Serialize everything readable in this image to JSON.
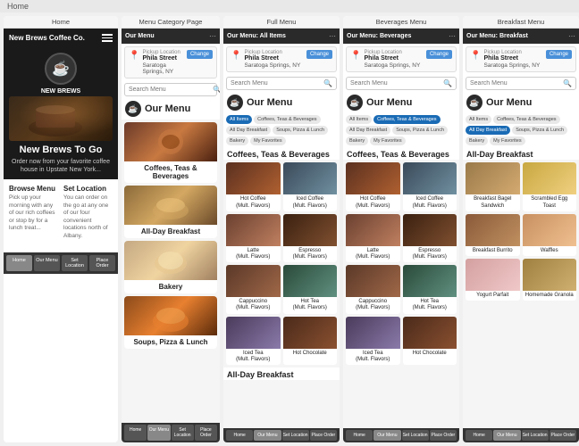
{
  "breadcrumb": "Home",
  "panels": {
    "home": {
      "label": "Home",
      "header": {
        "title": "New Brews Coffee Co.",
        "menu_icon": "☰"
      },
      "logo": "☕",
      "hero_title": "New Brews To Go",
      "hero_subtitle": "Order now from your favorite coffee house in Upstate New York...",
      "features": [
        {
          "title": "Browse Menu",
          "text": "Pick up your morning with any of our rich coffees or stop by for a lunch treat..."
        },
        {
          "title": "Set Location",
          "text": "You can order on the go at any one of our four convenient locations north of Albany."
        }
      ],
      "nav": [
        "Home",
        "Our Menu",
        "Set Location",
        "Place Order"
      ]
    },
    "menu_category": {
      "label": "Menu Category Page",
      "header_title": "Our Menu",
      "pickup": {
        "label": "Pickup Location",
        "address": "Phila Street",
        "city": "Saratoga Springs, NY",
        "change_btn": "Change"
      },
      "search_placeholder": "Search Menu",
      "our_menu_label": "Our Menu",
      "categories": [
        {
          "name": "Coffees, Teas & Beverages",
          "img": "coffee-img"
        },
        {
          "name": "All-Day Breakfast",
          "img": "breakfast-img"
        },
        {
          "name": "Bakery",
          "img": "bakery-img"
        },
        {
          "name": "Soups, Pizza & Lunch",
          "img": "soups-img"
        }
      ],
      "nav": [
        "Home",
        "Our Menu",
        "Set Location",
        "Place Order"
      ]
    },
    "full_menu": {
      "label": "Full Menu",
      "header_title": "Our Menu: All Items",
      "pickup": {
        "label": "Pickup Location",
        "address": "Phila Street",
        "city": "Saratoga Springs, NY",
        "change_btn": "Change"
      },
      "search_placeholder": "Search Menu",
      "our_menu_label": "Our Menu",
      "filter_tabs": [
        {
          "label": "All Items",
          "active": true
        },
        {
          "label": "Coffees, Teas & Beverages",
          "active": false
        },
        {
          "label": "All Day Breakfast",
          "active": false
        },
        {
          "label": "Soups, Pizza & Lunch",
          "active": false
        },
        {
          "label": "Bakery",
          "active": false
        },
        {
          "label": "My Favorites",
          "active": false
        }
      ],
      "sections": [
        {
          "title": "Coffees, Teas & Beverages",
          "items": [
            {
              "name": "Hot Coffee",
              "sub": "(Mult. Flavors)",
              "img": "hot-coffee"
            },
            {
              "name": "Iced Coffee",
              "sub": "(Mult. Flavors)",
              "img": "iced-coffee"
            },
            {
              "name": "Latte",
              "sub": "(Mult. Flavors)",
              "img": "latte"
            },
            {
              "name": "Espresso",
              "sub": "(Mult. Flavors)",
              "img": "espresso"
            },
            {
              "name": "Cappuccino",
              "sub": "(Mult. Flavors)",
              "img": "cappuccino"
            },
            {
              "name": "Hot Tea",
              "sub": "(Mult. Flavors)",
              "img": "hot-tea"
            },
            {
              "name": "Iced Tea",
              "sub": "(Mult. Flavors)",
              "img": "iced-tea"
            },
            {
              "name": "Hot Chocolate",
              "sub": "",
              "img": "hot-chocolate"
            }
          ]
        },
        {
          "title": "All-Day Breakfast",
          "items": []
        }
      ],
      "nav": [
        "Home",
        "Our Menu",
        "Set Location",
        "Place Order"
      ]
    },
    "beverages": {
      "label": "Beverages Menu",
      "header_title": "Our Menu: Beverages",
      "pickup": {
        "label": "Pickup Location",
        "address": "Phila Street",
        "city": "Saratoga Springs, NY",
        "change_btn": "Change"
      },
      "search_placeholder": "Search Menu",
      "our_menu_label": "Our Menu",
      "filter_tabs": [
        {
          "label": "All Items",
          "active": false
        },
        {
          "label": "Coffees, Teas & Beverages",
          "active": true
        },
        {
          "label": "All Day Breakfast",
          "active": false
        },
        {
          "label": "Soups, Pizza & Lunch",
          "active": false
        },
        {
          "label": "Bakery",
          "active": false
        },
        {
          "label": "My Favorites",
          "active": false
        }
      ],
      "section_title": "Coffees, Teas & Beverages",
      "items": [
        {
          "name": "Hot Coffee",
          "sub": "(Mult. Flavors)",
          "img": "hot-coffee"
        },
        {
          "name": "Iced Coffee",
          "sub": "(Mult. Flavors)",
          "img": "iced-coffee"
        },
        {
          "name": "Latte",
          "sub": "(Mult. Flavors)",
          "img": "latte"
        },
        {
          "name": "Espresso",
          "sub": "(Mult. Flavors)",
          "img": "espresso"
        },
        {
          "name": "Cappuccino",
          "sub": "(Mult. Flavors)",
          "img": "cappuccino"
        },
        {
          "name": "Hot Tea",
          "sub": "(Mult. Flavors)",
          "img": "hot-tea"
        },
        {
          "name": "Iced Tea",
          "sub": "(Mult. Flavors)",
          "img": "iced-tea"
        },
        {
          "name": "Hot Chocolate",
          "sub": "",
          "img": "hot-chocolate"
        }
      ],
      "nav": [
        "Home",
        "Our Menu",
        "Set Location",
        "Place Order"
      ]
    },
    "breakfast": {
      "label": "Breakfast Menu",
      "header_title": "Our Menu: Breakfast",
      "pickup": {
        "label": "Pickup Location",
        "address": "Phila Street",
        "city": "Saratoga Springs, NY",
        "change_btn": "Change"
      },
      "search_placeholder": "Search Menu",
      "our_menu_label": "Our Menu",
      "filter_tabs": [
        {
          "label": "All Items",
          "active": false
        },
        {
          "label": "Coffees, Teas & Beverages",
          "active": false
        },
        {
          "label": "All Day Breakfast",
          "active": true
        },
        {
          "label": "Soups, Pizza & Lunch",
          "active": false
        },
        {
          "label": "Bakery",
          "active": false
        },
        {
          "label": "My Favorites",
          "active": false
        }
      ],
      "section_title": "All-Day Breakfast",
      "items": [
        {
          "name": "Breakfast Bagel Sandwich",
          "sub": "",
          "img": "breakfast-bagel"
        },
        {
          "name": "Scrambled Egg Toast",
          "sub": "",
          "img": "scrambled-egg"
        },
        {
          "name": "Breakfast Burrito",
          "sub": "",
          "img": "breakfast-burrito"
        },
        {
          "name": "Waffles",
          "sub": "",
          "img": "waffles"
        },
        {
          "name": "Yogurt Parfait",
          "sub": "",
          "img": "yogurt"
        },
        {
          "name": "Homemade Granola",
          "sub": "",
          "img": "granola"
        }
      ],
      "nav": [
        "Home",
        "Our Menu",
        "Set Location",
        "Place Order"
      ]
    }
  }
}
